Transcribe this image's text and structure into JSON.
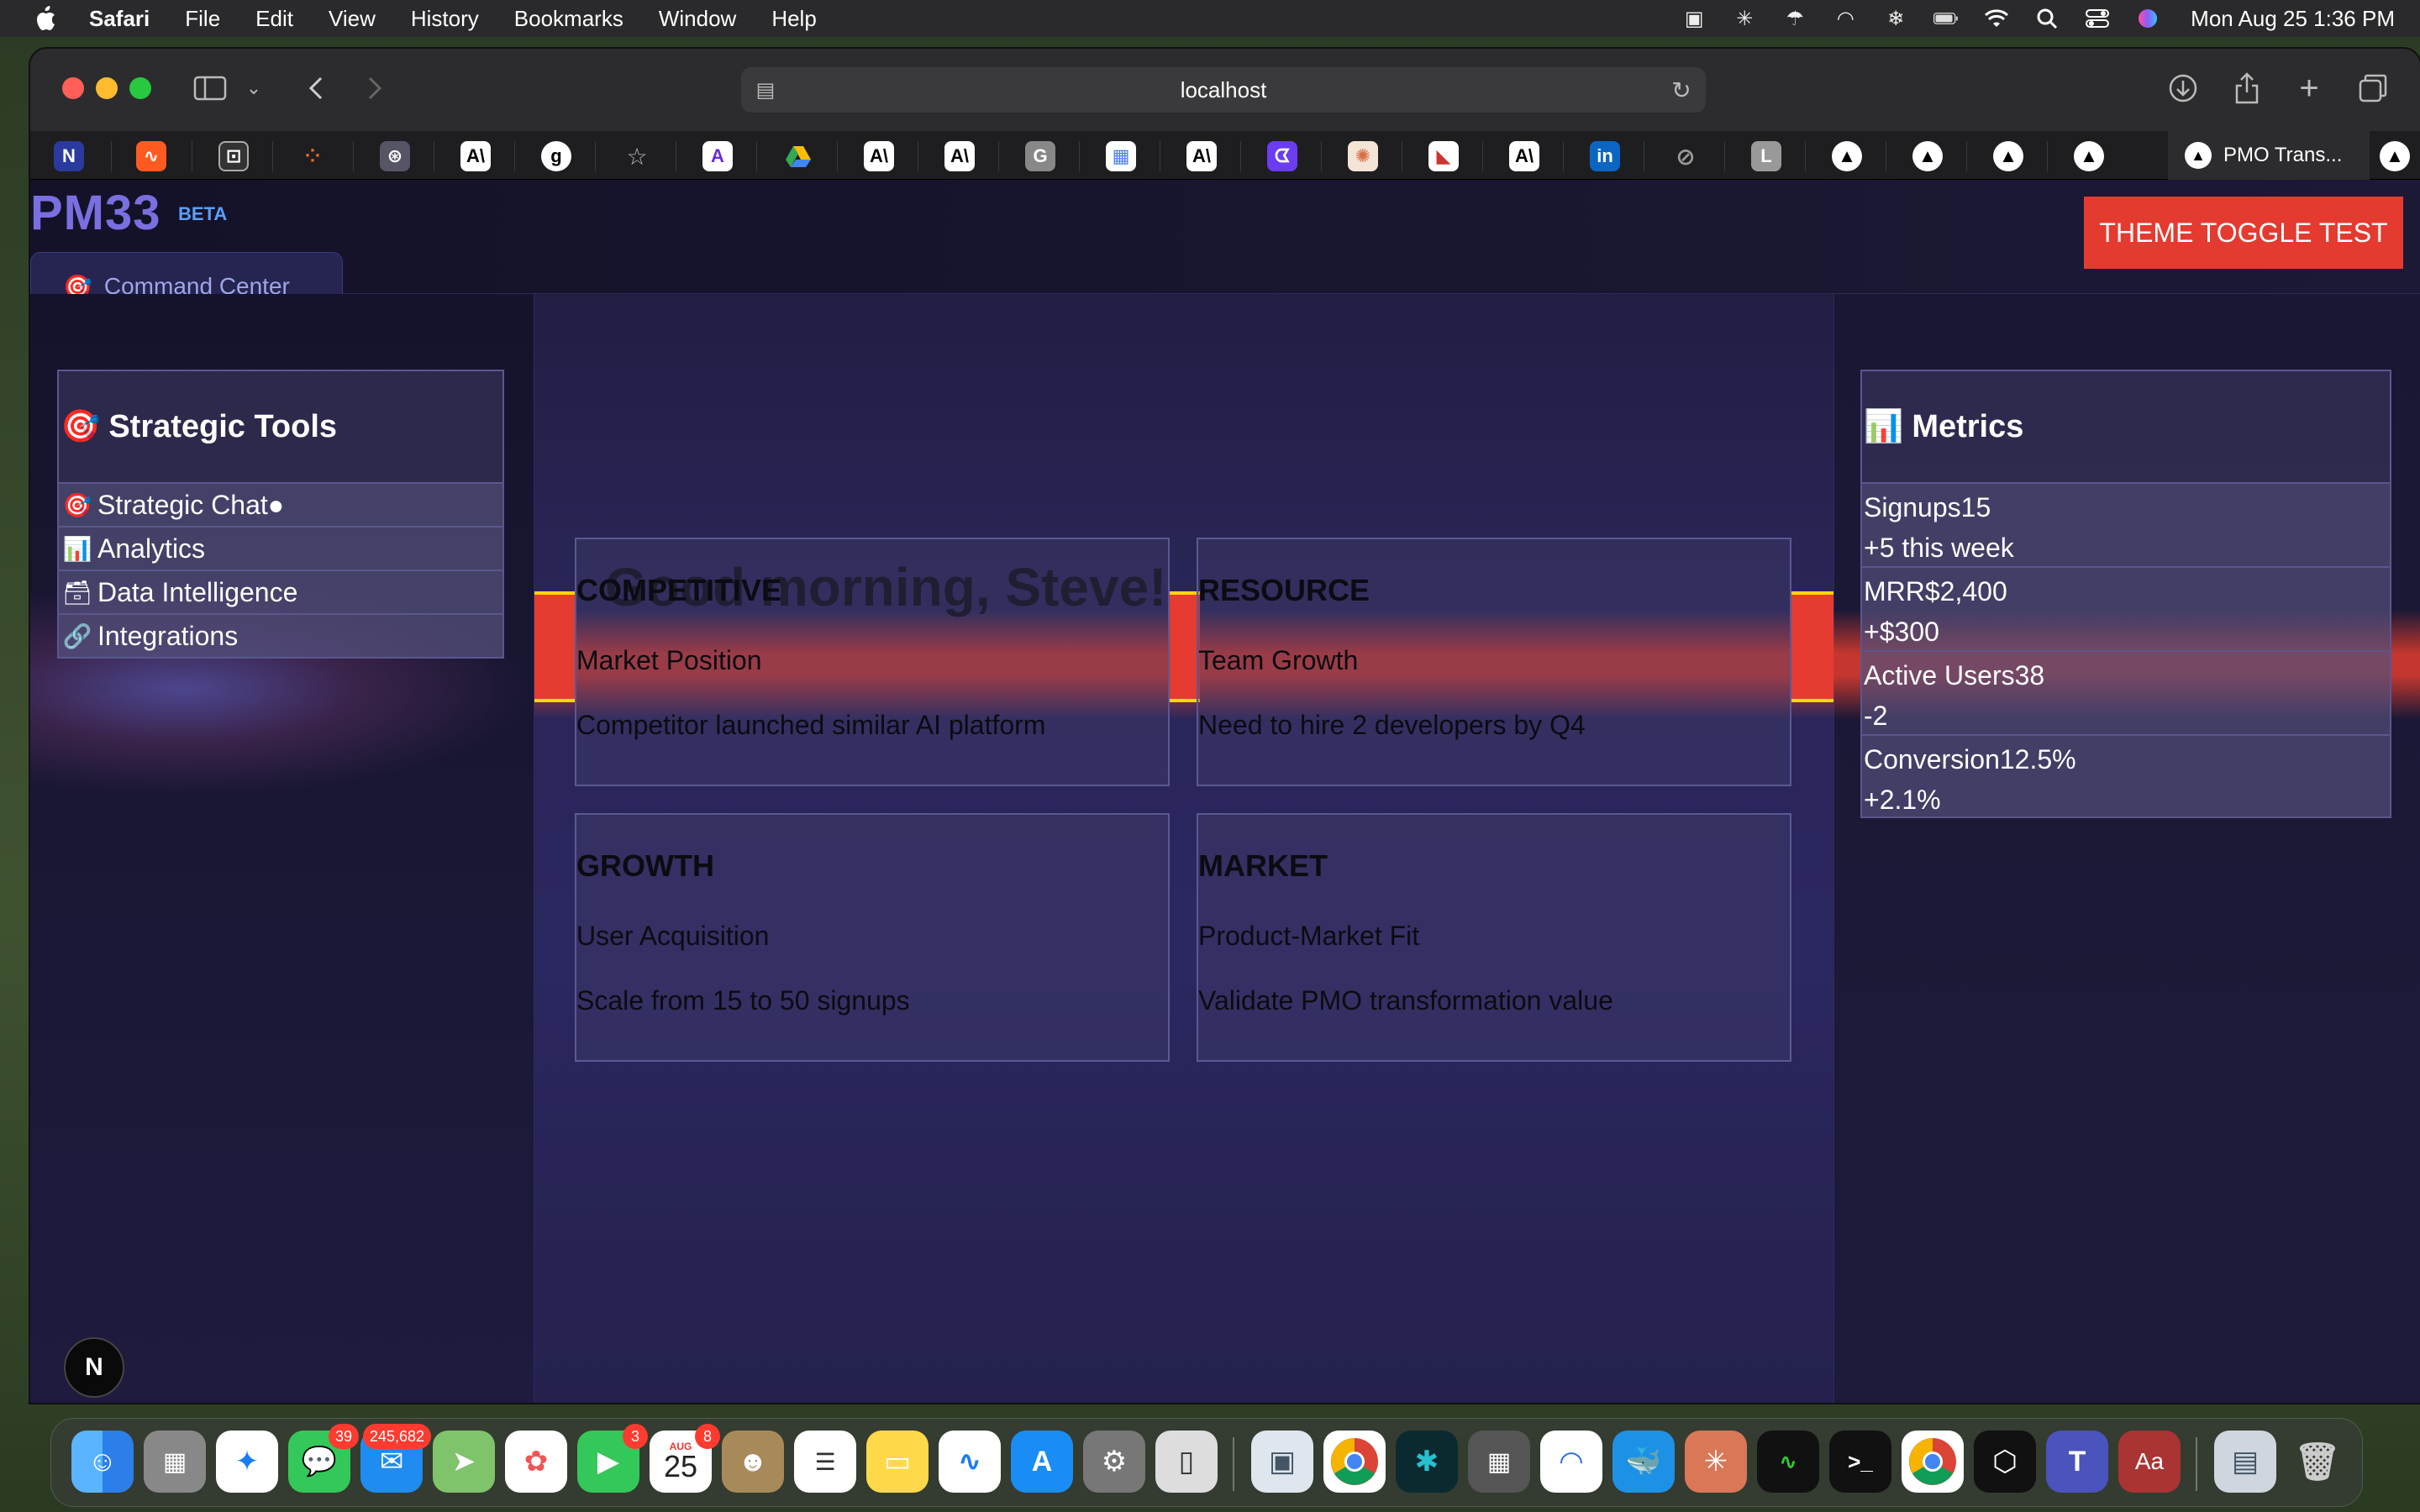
{
  "menubar": {
    "app_name": "Safari",
    "menus": [
      "File",
      "Edit",
      "View",
      "History",
      "Bookmarks",
      "Window",
      "Help"
    ],
    "clock": "Mon Aug 25  1:36 PM"
  },
  "browser": {
    "address": "localhost",
    "active_tab_title": "PMO Trans..."
  },
  "header": {
    "logo": "PM33",
    "badge": "BETA",
    "theme_button": "THEME TOGGLE TEST",
    "command_tab": "Command Center",
    "command_tab_emoji": "🎯"
  },
  "tools": {
    "title": "Strategic Tools",
    "title_emoji": "🎯",
    "items": [
      {
        "emoji": "🎯",
        "label": "Strategic Chat●"
      },
      {
        "emoji": "📊",
        "label": "Analytics"
      },
      {
        "emoji": "🗃",
        "label": "Data Intelligence"
      },
      {
        "emoji": "🔗",
        "label": "Integrations"
      }
    ]
  },
  "main": {
    "greeting": "Good morning, Steve!",
    "cards": [
      {
        "category": "COMPETITIVE",
        "title": "Market Position",
        "description": "Competitor launched similar AI platform"
      },
      {
        "category": "RESOURCE",
        "title": "Team Growth",
        "description": "Need to hire 2 developers by Q4"
      },
      {
        "category": "GROWTH",
        "title": "User Acquisition",
        "description": "Scale from 15 to 50 signups"
      },
      {
        "category": "MARKET",
        "title": "Product-Market Fit",
        "description": "Validate PMO transformation value"
      }
    ]
  },
  "metrics": {
    "title": "Metrics",
    "title_emoji": "📊",
    "items": [
      {
        "label": "Signups",
        "value": "15",
        "change": "+5 this week"
      },
      {
        "label": "MRR",
        "value": "$2,400",
        "change": "+$300"
      },
      {
        "label": "Active Users",
        "value": "38",
        "change": "-2"
      },
      {
        "label": "Conversion",
        "value": "12.5%",
        "change": "+2.1%"
      }
    ]
  },
  "nextjs_badge": "N",
  "dock": {
    "badges": {
      "messages": "39",
      "mail": "245,682",
      "facetime": "3",
      "calendar": "8"
    },
    "calendar_month": "AUG",
    "calendar_day": "25",
    "dictionary_label": "Aa"
  },
  "colors": {
    "accent_red": "#e53a2f",
    "logo_purple": "#7a6fe0",
    "beta_blue": "#5aa0ff",
    "highlight_yellow": "#ffd700"
  }
}
